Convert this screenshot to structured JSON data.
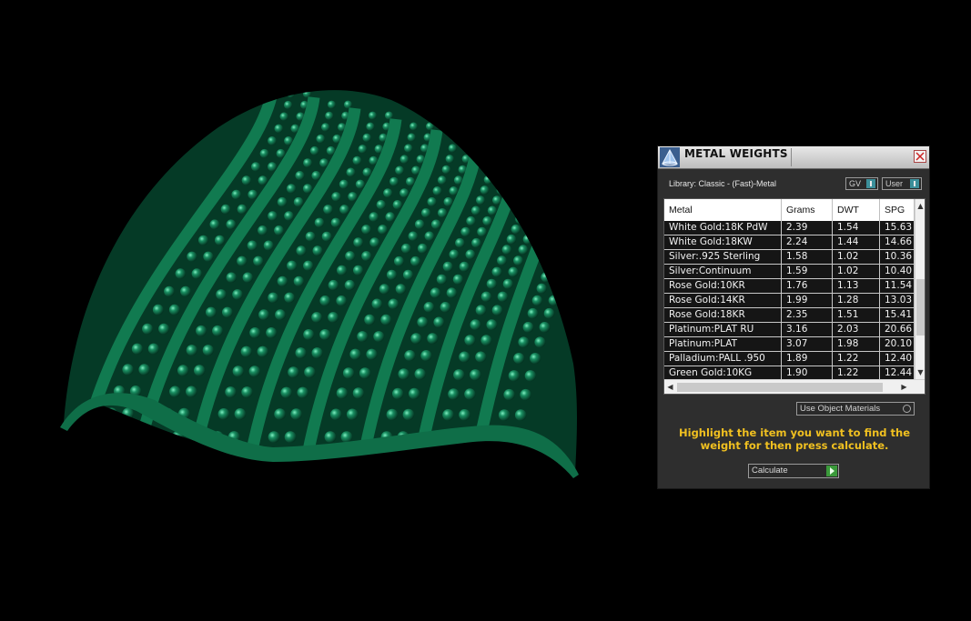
{
  "viewport": {
    "label": "3d-ring-model",
    "material_color": "#0d6b4a"
  },
  "panel": {
    "title": "METAL WEIGHTS",
    "library_label": "Library: Classic - (Fast)-Metal",
    "toggles": {
      "gv_label": "GV",
      "user_label": "User"
    },
    "table": {
      "columns": [
        "Metal",
        "Grams",
        "DWT",
        "SPG"
      ],
      "rows": [
        [
          "White Gold:18K PdW",
          "2.39",
          "1.54",
          "15.63"
        ],
        [
          "White Gold:18KW",
          "2.24",
          "1.44",
          "14.66"
        ],
        [
          "Silver:.925 Sterling",
          "1.58",
          "1.02",
          "10.36"
        ],
        [
          "Silver:Continuum",
          "1.59",
          "1.02",
          "10.40"
        ],
        [
          "Rose Gold:10KR",
          "1.76",
          "1.13",
          "11.54"
        ],
        [
          "Rose Gold:14KR",
          "1.99",
          "1.28",
          "13.03"
        ],
        [
          "Rose Gold:18KR",
          "2.35",
          "1.51",
          "15.41"
        ],
        [
          "Platinum:PLAT RU",
          "3.16",
          "2.03",
          "20.66"
        ],
        [
          "Platinum:PLAT",
          "3.07",
          "1.98",
          "20.10"
        ],
        [
          "Palladium:PALL .950",
          "1.89",
          "1.22",
          "12.40"
        ],
        [
          "Green Gold:10KG",
          "1.90",
          "1.22",
          "12.44"
        ]
      ]
    },
    "use_object_materials_label": "Use Object Materials",
    "instructions": "Highlight the item you want to find the weight for then press calculate.",
    "calculate_label": "Calculate",
    "colors": {
      "accent_text": "#f0c020",
      "panel_bg": "#2e2e2e",
      "toggle_knob": "#3b8f9a",
      "go_button": "#3a9a3a"
    }
  }
}
